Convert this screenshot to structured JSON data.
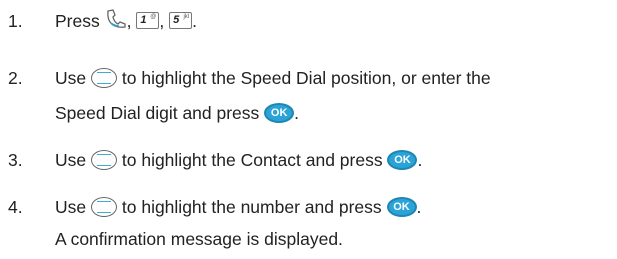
{
  "steps": [
    {
      "number": "1.",
      "lines": [
        {
          "text_before": "Press",
          "sep1": ",",
          "sep2": ",",
          "end": "."
        }
      ],
      "keys": {
        "key1_digit": "1",
        "key1_sub": "@",
        "key5_digit": "5",
        "key5_sub": "jkl"
      }
    },
    {
      "number": "2.",
      "line1_before": "Use",
      "line1_after": "to highlight the Speed Dial position, or enter the",
      "line2_before": "Speed Dial digit and press",
      "line2_after": "."
    },
    {
      "number": "3.",
      "before": "Use",
      "middle": "to highlight the Contact and press",
      "after": "."
    },
    {
      "number": "4.",
      "before": "Use",
      "middle": "to highlight the number and press",
      "after": ".",
      "line2": "A confirmation message is displayed."
    }
  ],
  "ok_label": "OK",
  "icons": {
    "send": "send-key-icon",
    "nav": "navigation-key-icon",
    "ok": "ok-key-icon"
  },
  "colors": {
    "accent": "#2aa3d6",
    "text": "#222222"
  }
}
